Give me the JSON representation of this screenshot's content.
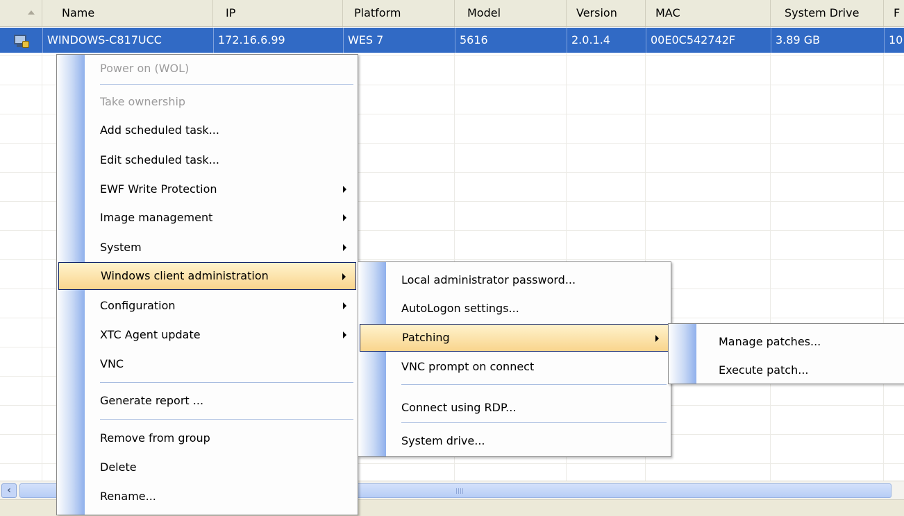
{
  "columns": [
    "Name",
    "IP",
    "Platform",
    "Model",
    "Version",
    "MAC",
    "System Drive",
    "F"
  ],
  "selected_row": {
    "name": "WINDOWS-C817UCC",
    "ip": "172.16.6.99",
    "platform": "WES 7",
    "model": "5616",
    "version": "2.0.1.4",
    "mac": "00E0C542742F",
    "system_drive": "3.89 GB",
    "extra": "10",
    "icon": "thin-client-icon"
  },
  "context_menu": {
    "items": [
      {
        "label": "Power on (WOL)",
        "disabled": true
      },
      {
        "label": "Take ownership",
        "disabled": true
      },
      {
        "label": "Add scheduled task..."
      },
      {
        "label": "Edit scheduled task..."
      },
      {
        "label": "EWF Write Protection",
        "submenu": true
      },
      {
        "label": "Image management",
        "submenu": true
      },
      {
        "label": "System",
        "submenu": true
      },
      {
        "label": "Windows client administration",
        "submenu": true,
        "highlighted": true
      },
      {
        "label": "Configuration",
        "submenu": true
      },
      {
        "label": "XTC Agent update",
        "submenu": true
      },
      {
        "label": "VNC"
      },
      {
        "label": "Generate report ..."
      },
      {
        "label": "Remove from group"
      },
      {
        "label": "Delete"
      },
      {
        "label": "Rename..."
      }
    ]
  },
  "submenu_windows_admin": {
    "items": [
      {
        "label": "Local administrator password..."
      },
      {
        "label": "AutoLogon settings..."
      },
      {
        "label": "Patching",
        "submenu": true,
        "highlighted": true
      },
      {
        "label": "VNC prompt on connect"
      },
      {
        "label": "Connect using RDP..."
      },
      {
        "label": "System drive..."
      }
    ]
  },
  "submenu_patching": {
    "items": [
      {
        "label": "Manage patches..."
      },
      {
        "label": "Execute patch..."
      }
    ]
  },
  "colors": {
    "selection": "#316ac5",
    "menu_highlight": "#f9d58d",
    "menu_highlight_border": "#10246a",
    "gutter": "#8fb0ec"
  }
}
